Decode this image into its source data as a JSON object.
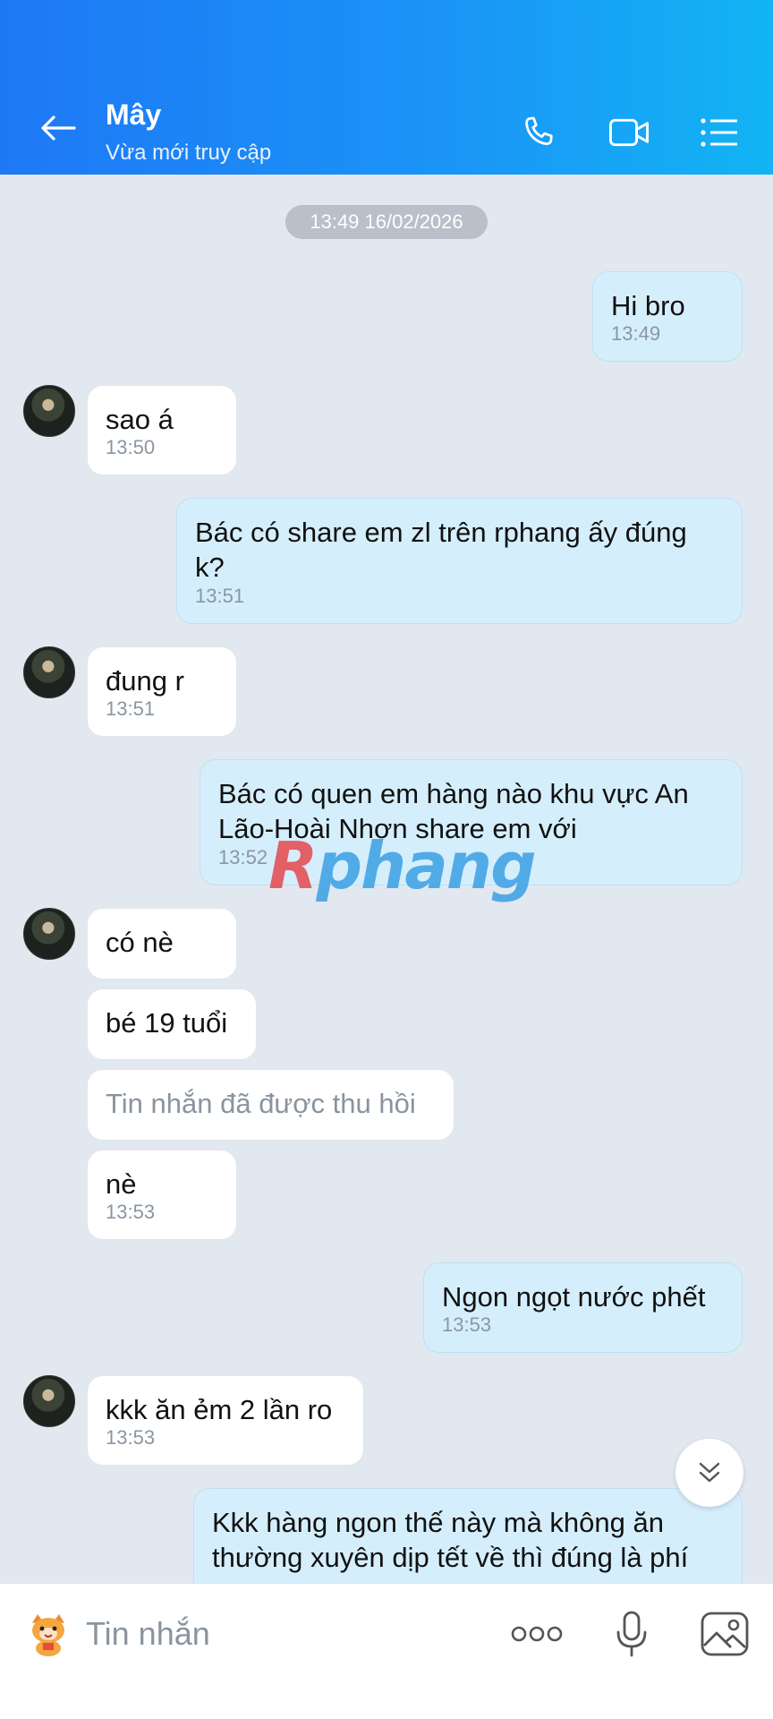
{
  "header": {
    "contact_name": "Mây",
    "status": "Vừa mới truy cập",
    "icons": [
      "back-arrow-icon",
      "phone-icon",
      "video-call-icon",
      "list-menu-icon"
    ]
  },
  "chat": {
    "date_separator": "13:49 16/02/2026",
    "messages": [
      {
        "from": "me",
        "text": "Hi bro",
        "time": "13:49"
      },
      {
        "from": "them",
        "text": "sao á",
        "time": "13:50"
      },
      {
        "from": "me",
        "text": "Bác có share em zl trên rphang ấy đúng\nk?",
        "time": "13:51"
      },
      {
        "from": "them",
        "text": "đung r",
        "time": "13:51"
      },
      {
        "from": "me",
        "text": "Bác có quen em hàng nào khu vực An\nLão-Hoài Nhơn share em với",
        "time": "13:52"
      },
      {
        "from": "them",
        "text": "có nè",
        "time": ""
      },
      {
        "from": "them",
        "text": "bé 19 tuổi",
        "time": ""
      },
      {
        "from": "them",
        "text": "Tin nhắn đã được thu hồi",
        "time": "",
        "recalled": true
      },
      {
        "from": "them",
        "text": "nè",
        "time": "13:53"
      },
      {
        "from": "me",
        "text": "Ngon ngọt nước phết",
        "time": "13:53"
      },
      {
        "from": "them",
        "text": "kkk ăn ẻm 2 lần ro",
        "time": "13:53"
      },
      {
        "from": "me",
        "text": "Kkk hàng ngon thế này mà không ăn\nthường xuyên dịp tết về thì đúng là phí",
        "time": ""
      }
    ],
    "watermark_r": "R",
    "watermark_rest": "phang"
  },
  "input_bar": {
    "placeholder": "Tin nhắn",
    "icons": [
      "sticker-icon",
      "more-options-icon",
      "microphone-icon",
      "image-icon"
    ]
  },
  "colors": {
    "header_gradient_start": "#1e78f5",
    "header_gradient_end": "#12b4f3",
    "my_bubble": "#d5eefc",
    "their_bubble": "#ffffff",
    "chat_background": "#e2e8f0"
  }
}
